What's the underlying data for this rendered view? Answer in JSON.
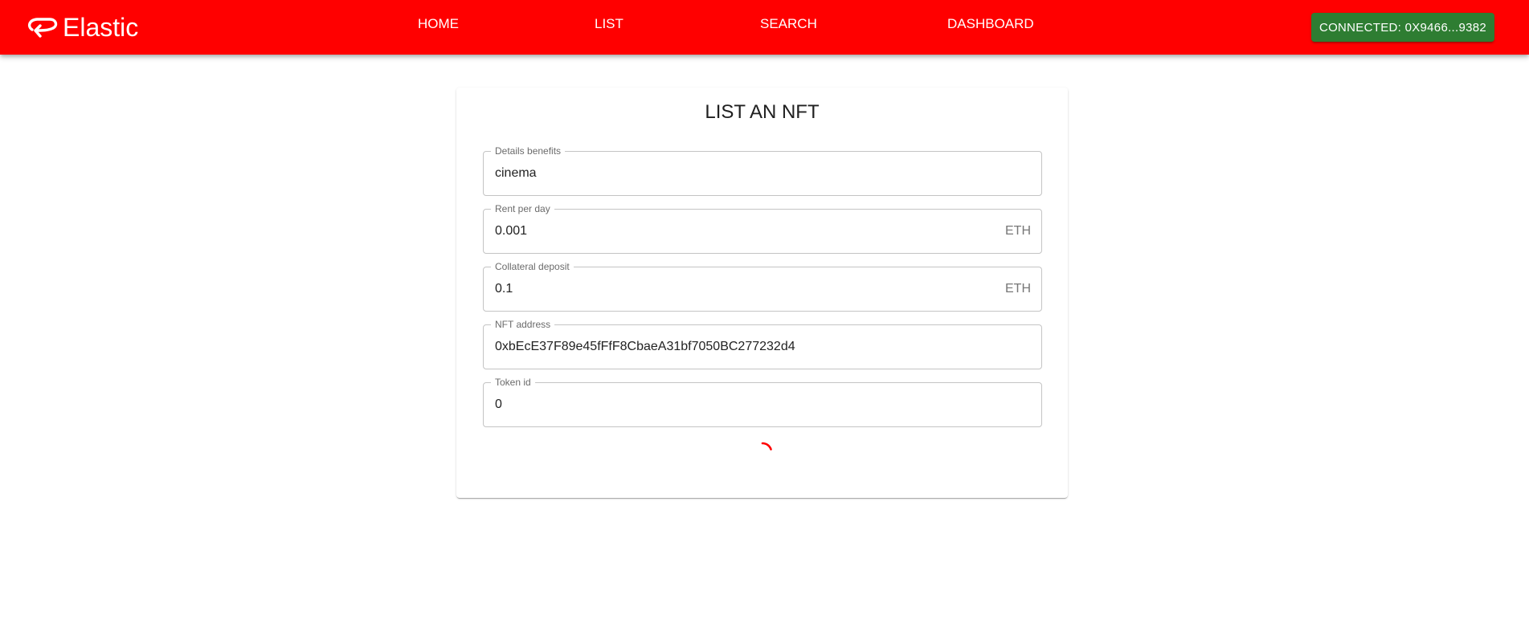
{
  "app": {
    "brand": "Elastic",
    "brand_icon": "swap-arrow-icon",
    "colors": {
      "appbar": "#ff0000",
      "connect_button": "#2e7d32",
      "spinner": "#ff0000"
    }
  },
  "nav": {
    "home": "HOME",
    "list": "LIST",
    "search": "SEARCH",
    "dashboard": "DASHBOARD"
  },
  "wallet": {
    "button_label": "CONNECTED: 0X9466...9382"
  },
  "form": {
    "title": "LIST AN NFT",
    "fields": {
      "details": {
        "label": "Details benefits",
        "value": "cinema"
      },
      "rent": {
        "label": "Rent per day",
        "value": "0.001",
        "unit": "ETH"
      },
      "collateral": {
        "label": "Collateral deposit",
        "value": "0.1",
        "unit": "ETH"
      },
      "nft_address": {
        "label": "NFT address",
        "value": "0xbEcE37F89e45fFfF8CbaeA31bf7050BC277232d4"
      },
      "token_id": {
        "label": "Token id",
        "value": "0"
      }
    },
    "status": "loading"
  }
}
